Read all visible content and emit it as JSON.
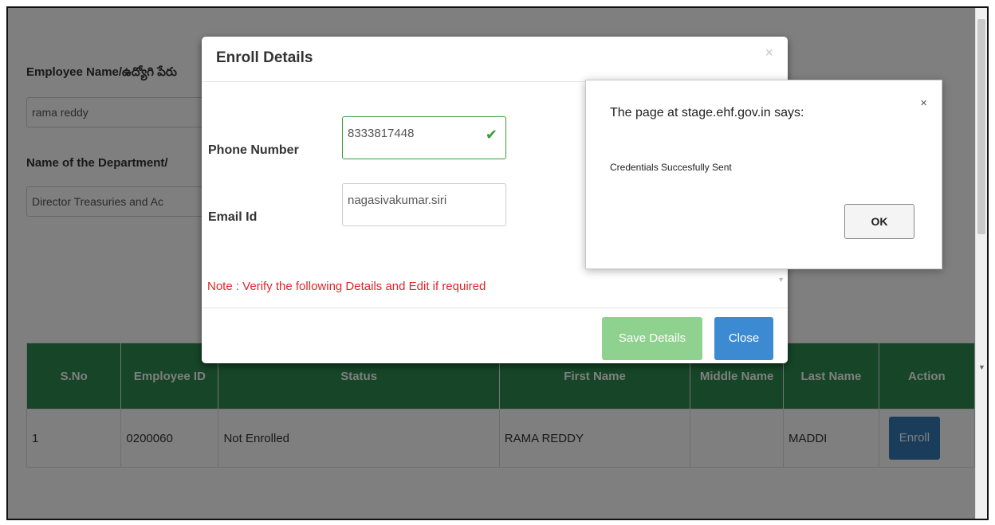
{
  "form": {
    "employee_name_label": "Employee Name/ఉద్యోగి పేరు",
    "employee_name_value": "rama reddy",
    "department_label": "Name of the Department/",
    "department_value": "Director Treasuries and Ac"
  },
  "table": {
    "headers": [
      "S.No",
      "Employee ID",
      "Status",
      "First Name",
      "Middle Name",
      "Last Name",
      "Action"
    ],
    "rows": [
      {
        "sno": "1",
        "employee_id": "0200060",
        "status": "Not Enrolled",
        "first_name": "RAMA REDDY",
        "middle_name": "",
        "last_name": "MADDI",
        "action": "Enroll"
      }
    ]
  },
  "modal": {
    "title": "Enroll Details",
    "close_x": "×",
    "phone_label": "Phone Number",
    "phone_value": "8333817448",
    "email_label": "Email Id",
    "email_value": "nagasivakumar.siri",
    "note": "Note : Verify the following Details and Edit if required",
    "save_label": "Save Details",
    "close_label": "Close"
  },
  "alert": {
    "title": "The page at stage.ehf.gov.in says:",
    "close_x": "×",
    "message": "Credentials Succesfully Sent",
    "ok_label": "OK"
  },
  "colors": {
    "table_header": "#2d8a4e",
    "enroll_button": "#337ab7",
    "save_button": "#8fd18f",
    "close_button": "#3b8ad2",
    "note_text": "#e0252b",
    "valid_check": "#3c9a3c"
  },
  "icons": {
    "phone_valid": "check-icon"
  }
}
